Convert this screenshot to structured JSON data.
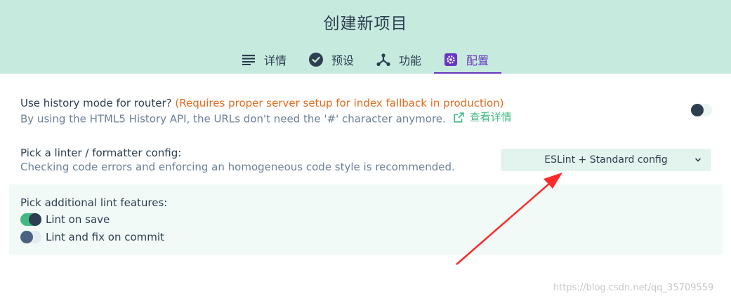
{
  "header": {
    "title": "创建新项目",
    "tabs": [
      {
        "label": "详情",
        "icon": "list-icon",
        "active": false
      },
      {
        "label": "预设",
        "icon": "check-circle-icon",
        "active": false
      },
      {
        "label": "功能",
        "icon": "fork-icon",
        "active": false
      },
      {
        "label": "配置",
        "icon": "gear-icon",
        "active": true
      }
    ]
  },
  "history": {
    "label": "Use history mode for router?",
    "warning": "(Requires proper server setup for index fallback in production)",
    "description": "By using the HTML5 History API, the URLs don't need the '#' character anymore.",
    "link": "查看详情",
    "enabled": false
  },
  "linter": {
    "label": "Pick a linter / formatter config:",
    "description": "Checking code errors and enforcing an homogeneous code style is recommended.",
    "selected": "ESLint + Standard config"
  },
  "lint_features": {
    "label": "Pick additional lint features:",
    "items": [
      {
        "label": "Lint on save",
        "enabled": true
      },
      {
        "label": "Lint and fix on commit",
        "enabled": false
      }
    ]
  },
  "watermark": "https://blog.csdn.net/qq_35709559",
  "colors": {
    "header_bg": "#c6eade",
    "accent": "#6a35c0",
    "green": "#42b983",
    "warning": "#e26b1e",
    "annotation_arrow": "#ff2a2a"
  }
}
